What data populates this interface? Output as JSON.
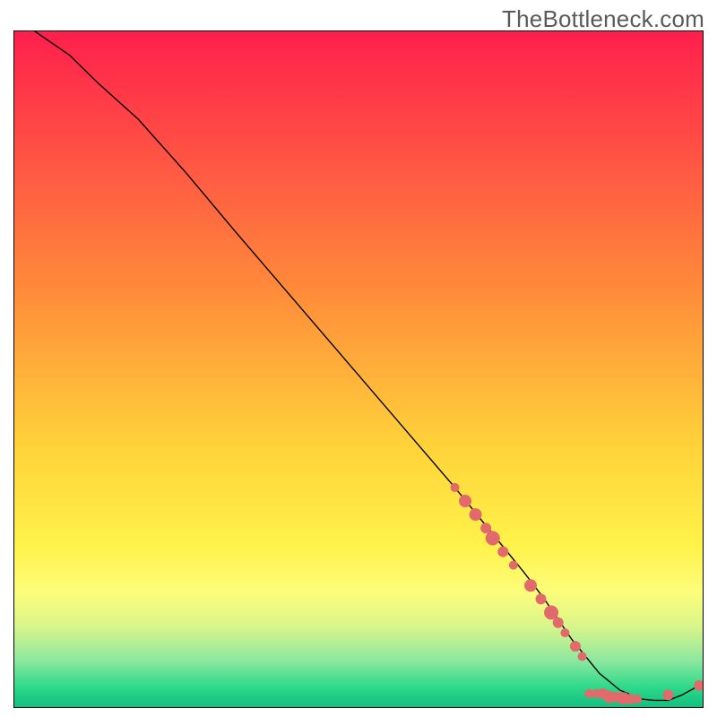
{
  "watermark": "TheBottleneck.com",
  "chart_data": {
    "type": "line",
    "title": "",
    "xlabel": "",
    "ylabel": "",
    "xlim": [
      0,
      100
    ],
    "ylim": [
      0,
      100
    ],
    "background_gradient": {
      "type": "vertical",
      "stops": [
        {
          "pos": 0.0,
          "color": "#ff1f4d"
        },
        {
          "pos": 0.38,
          "color": "#ff8a3a"
        },
        {
          "pos": 0.62,
          "color": "#ffd43a"
        },
        {
          "pos": 0.76,
          "color": "#fff24a"
        },
        {
          "pos": 0.83,
          "color": "#fdfd7a"
        },
        {
          "pos": 0.88,
          "color": "#d9f58a"
        },
        {
          "pos": 0.93,
          "color": "#8fe8a0"
        },
        {
          "pos": 0.97,
          "color": "#2fd98a"
        },
        {
          "pos": 1.0,
          "color": "#10c080"
        }
      ]
    },
    "series": [
      {
        "name": "curve",
        "color": "#000000",
        "stroke_width": 1.4,
        "x": [
          3,
          8,
          12,
          18,
          25,
          32,
          40,
          48,
          56,
          64,
          70,
          74,
          77,
          79,
          81,
          83,
          85,
          88,
          91,
          93,
          95,
          97,
          99.5
        ],
        "y": [
          100,
          96.5,
          92.5,
          87,
          79,
          70.5,
          61,
          51.5,
          42,
          32.5,
          25,
          20,
          16,
          13,
          10,
          7.5,
          5,
          2.5,
          1.2,
          1,
          1,
          1.8,
          3.2
        ]
      }
    ],
    "points": {
      "name": "dots",
      "color": "#e26a6a",
      "radius_range": [
        4,
        9
      ],
      "data": [
        {
          "x": 64.0,
          "y": 32.5,
          "r": 5
        },
        {
          "x": 65.5,
          "y": 30.5,
          "r": 7
        },
        {
          "x": 67.0,
          "y": 28.5,
          "r": 7
        },
        {
          "x": 68.5,
          "y": 26.5,
          "r": 6
        },
        {
          "x": 69.5,
          "y": 25.0,
          "r": 8
        },
        {
          "x": 71.0,
          "y": 23.0,
          "r": 6
        },
        {
          "x": 72.5,
          "y": 21.0,
          "r": 5
        },
        {
          "x": 75.0,
          "y": 18.0,
          "r": 7
        },
        {
          "x": 76.5,
          "y": 16.0,
          "r": 6
        },
        {
          "x": 78.0,
          "y": 14.0,
          "r": 8
        },
        {
          "x": 79.0,
          "y": 12.5,
          "r": 6
        },
        {
          "x": 80.0,
          "y": 11.0,
          "r": 5
        },
        {
          "x": 81.5,
          "y": 9.0,
          "r": 6
        },
        {
          "x": 82.5,
          "y": 7.5,
          "r": 5
        },
        {
          "x": 83.5,
          "y": 2.0,
          "r": 5
        },
        {
          "x": 84.5,
          "y": 2.0,
          "r": 5
        },
        {
          "x": 85.5,
          "y": 2.0,
          "r": 6
        },
        {
          "x": 86.5,
          "y": 1.5,
          "r": 7
        },
        {
          "x": 87.5,
          "y": 1.5,
          "r": 6
        },
        {
          "x": 88.5,
          "y": 1.3,
          "r": 7
        },
        {
          "x": 89.5,
          "y": 1.2,
          "r": 6
        },
        {
          "x": 90.5,
          "y": 1.2,
          "r": 5
        },
        {
          "x": 95.0,
          "y": 1.8,
          "r": 6
        },
        {
          "x": 99.5,
          "y": 3.2,
          "r": 6
        }
      ]
    }
  }
}
